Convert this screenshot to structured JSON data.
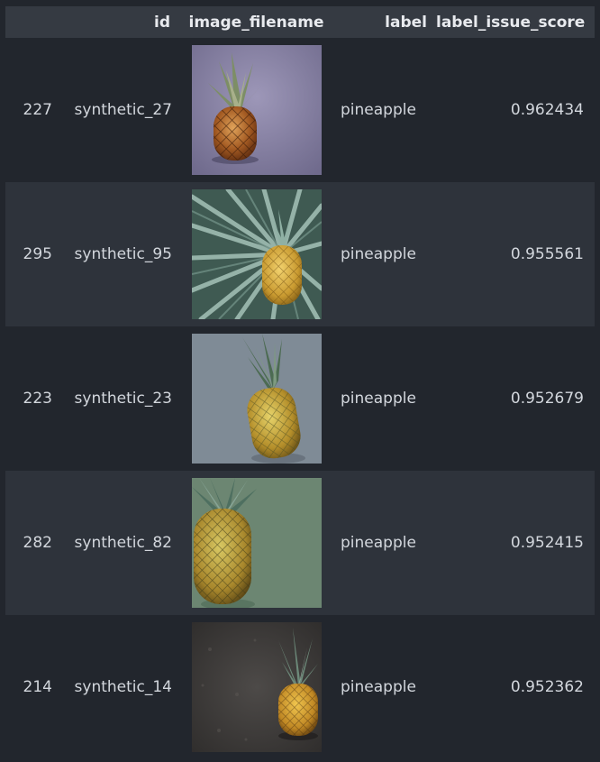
{
  "table": {
    "columns": [
      "",
      "id",
      "image_filename",
      "label",
      "label_issue_score"
    ],
    "rows": [
      {
        "index": "227",
        "id": "synthetic_27",
        "thumb_icon": "pineapple-photo-purple-backdrop",
        "label": "pineapple",
        "score": "0.962434"
      },
      {
        "index": "295",
        "id": "synthetic_95",
        "thumb_icon": "pineapple-photo-palm-leaves",
        "label": "pineapple",
        "score": "0.955561"
      },
      {
        "index": "223",
        "id": "synthetic_23",
        "thumb_icon": "pineapple-photo-grey-backdrop",
        "label": "pineapple",
        "score": "0.952679"
      },
      {
        "index": "282",
        "id": "synthetic_82",
        "thumb_icon": "pineapple-photo-green-backdrop",
        "label": "pineapple",
        "score": "0.952415"
      },
      {
        "index": "214",
        "id": "synthetic_14",
        "thumb_icon": "pineapple-photo-dark-stone",
        "label": "pineapple",
        "score": "0.952362"
      }
    ]
  }
}
